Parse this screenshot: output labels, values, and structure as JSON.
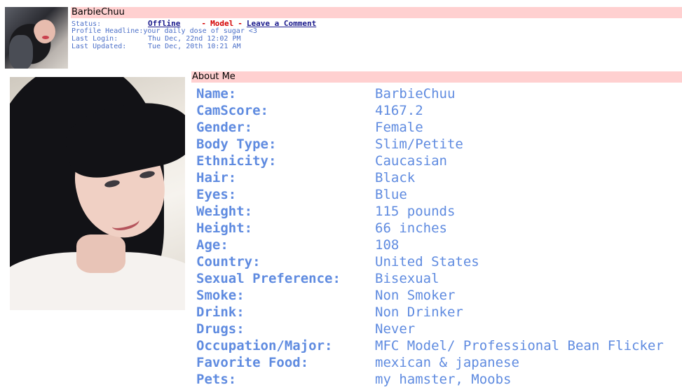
{
  "header": {
    "username": "BarbieChuu",
    "status_label": "Status:",
    "status_value": "Offline",
    "dash1": "-",
    "model_label": "Model",
    "dash2": "-",
    "leave_comment": "Leave a Comment",
    "headline_label": "Profile Headline:",
    "headline_value": "your daily dose of sugar <3",
    "last_login_label": "Last Login:",
    "last_login_value": "Thu Dec, 22nd 12:02 PM",
    "last_updated_label": "Last Updated:",
    "last_updated_value": "Tue Dec, 20th 10:21 AM"
  },
  "about": {
    "title": "About Me",
    "fields": [
      {
        "label": "Name:",
        "value": "BarbieChuu"
      },
      {
        "label": "CamScore:",
        "value": "4167.2"
      },
      {
        "label": "Gender:",
        "value": "Female"
      },
      {
        "label": "Body Type:",
        "value": "Slim/Petite"
      },
      {
        "label": "Ethnicity:",
        "value": "Caucasian"
      },
      {
        "label": "Hair:",
        "value": "Black"
      },
      {
        "label": "Eyes:",
        "value": "Blue"
      },
      {
        "label": "Weight:",
        "value": "115 pounds"
      },
      {
        "label": "Height:",
        "value": "66 inches"
      },
      {
        "label": "Age:",
        "value": "108"
      },
      {
        "label": "Country:",
        "value": "United States"
      },
      {
        "label": "Sexual Preference:",
        "value": "Bisexual"
      },
      {
        "label": "Smoke:",
        "value": "Non Smoker"
      },
      {
        "label": "Drink:",
        "value": "Non Drinker"
      },
      {
        "label": "Drugs:",
        "value": "Never"
      },
      {
        "label": "Occupation/Major:",
        "value": "MFC Model/ Professional Bean Flicker"
      },
      {
        "label": "Favorite Food:",
        "value": "mexican & japanese"
      },
      {
        "label": "Pets:",
        "value": "my hamster, Moobs"
      }
    ]
  },
  "colors": {
    "bar_bg": "#ffd0d0",
    "info_text": "#4b6fc8",
    "field_text": "#5f8be0",
    "status_link": "#1a1a8c",
    "model_red": "#d40000"
  }
}
